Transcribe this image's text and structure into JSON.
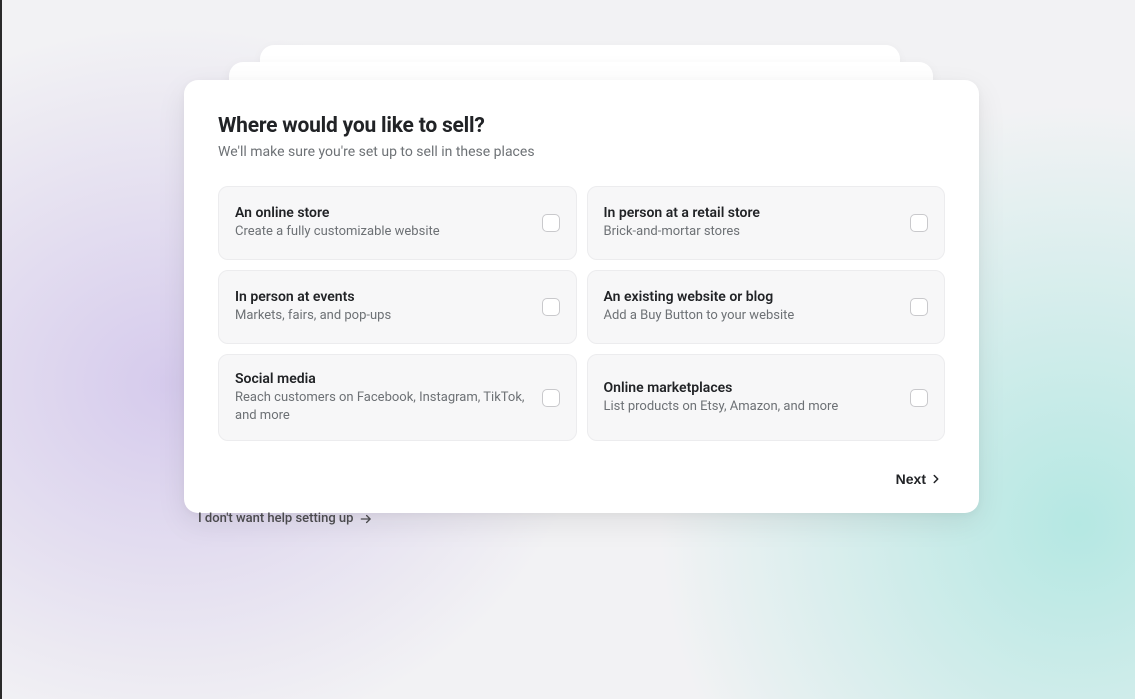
{
  "heading": "Where would you like to sell?",
  "subheading": "We'll make sure you're set up to sell in these places",
  "options": [
    {
      "title": "An online store",
      "desc": "Create a fully customizable website"
    },
    {
      "title": "In person at a retail store",
      "desc": "Brick-and-mortar stores"
    },
    {
      "title": "In person at events",
      "desc": "Markets, fairs, and pop-ups"
    },
    {
      "title": "An existing website or blog",
      "desc": "Add a Buy Button to your website"
    },
    {
      "title": "Social media",
      "desc": "Reach customers on Facebook, Instagram, TikTok, and more"
    },
    {
      "title": "Online marketplaces",
      "desc": "List products on Etsy, Amazon, and more"
    }
  ],
  "nextLabel": "Next",
  "skipLabel": "I don't want help setting up"
}
